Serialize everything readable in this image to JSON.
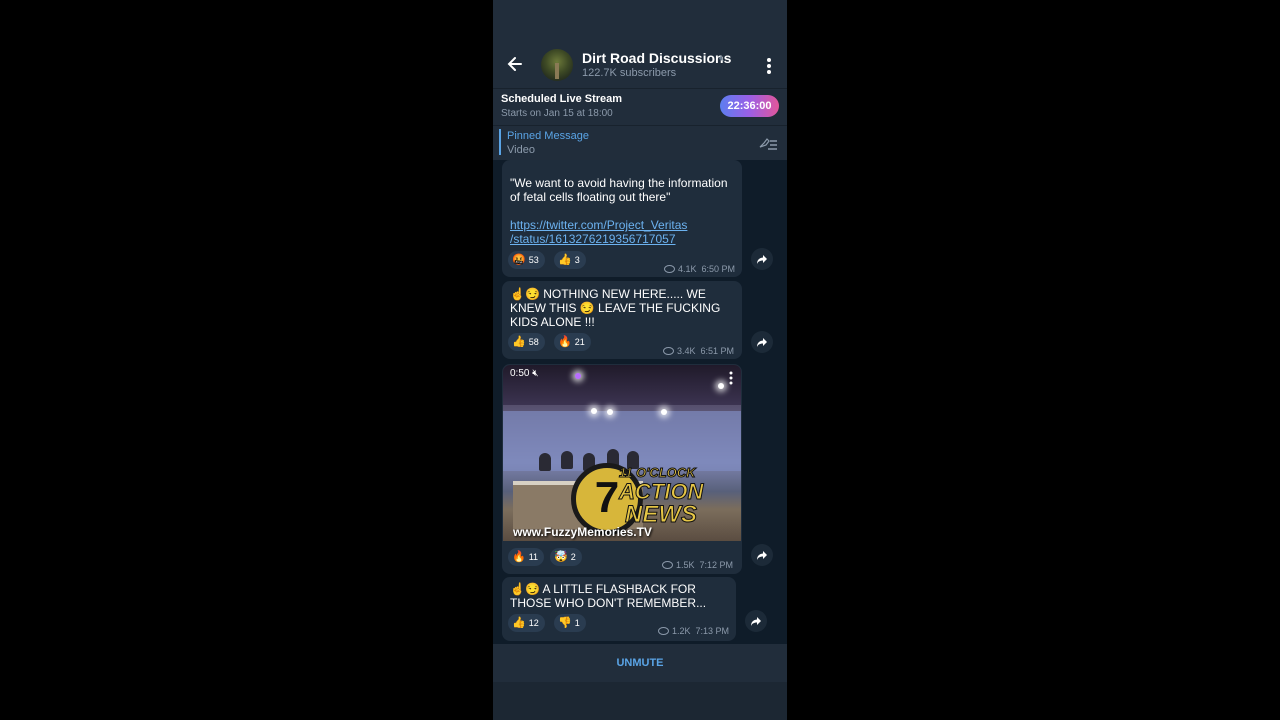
{
  "header": {
    "channel_name": "Dirt Road Discussions",
    "subscribers": "122.7K subscribers"
  },
  "live_stream": {
    "title": "Scheduled Live Stream",
    "subtitle": "Starts on Jan 15 at 18:00",
    "countdown": "22:36:00"
  },
  "pinned": {
    "title": "Pinned Message",
    "preview": "Video"
  },
  "messages": [
    {
      "text": "\"We want to avoid having the information of fetal cells floating out there\"",
      "link": "https://twitter.com/Project_Veritas/status/1613276219356717057",
      "link_line1": "https://twitter.com/Project_Veritas",
      "link_line2": "/status/1613276219356717057",
      "reactions": [
        {
          "emoji": "🤬",
          "count": "53"
        },
        {
          "emoji": "👍",
          "count": "3"
        }
      ],
      "views": "4.1K",
      "time": "6:50 PM"
    },
    {
      "text": "☝️😏 NOTHING NEW HERE..... WE KNEW THIS 😏 LEAVE THE FUCKING KIDS ALONE !!!",
      "reactions": [
        {
          "emoji": "👍",
          "count": "58"
        },
        {
          "emoji": "🔥",
          "count": "21"
        }
      ],
      "views": "3.4K",
      "time": "6:51 PM"
    },
    {
      "video": {
        "duration": "0:50",
        "watermark": "www.FuzzyMemories.TV",
        "logo_number": "7",
        "logo_line1": "11 O'CLOCK",
        "logo_line2": "ACTION",
        "logo_line3": "NEWS"
      },
      "reactions": [
        {
          "emoji": "🔥",
          "count": "11"
        },
        {
          "emoji": "🤯",
          "count": "2"
        }
      ],
      "views": "1.5K",
      "time": "7:12 PM"
    },
    {
      "text": "☝️😏 A LITTLE FLASHBACK FOR THOSE WHO DON'T REMEMBER...",
      "reactions": [
        {
          "emoji": "👍",
          "count": "12"
        },
        {
          "emoji": "👎",
          "count": "1"
        }
      ],
      "views": "1.2K",
      "time": "7:13 PM"
    }
  ],
  "footer": {
    "unmute_label": "UNMUTE"
  },
  "colors": {
    "accent": "#5aa4e6",
    "header_bg": "#212d3b",
    "chat_bg": "#0f1c29",
    "bubble_bg": "#1f2d3c"
  },
  "icons": [
    "back-arrow-icon",
    "muted-icon",
    "more-vert-icon",
    "unpin-list-icon",
    "share-icon",
    "eye-icon",
    "volume-off-icon"
  ]
}
